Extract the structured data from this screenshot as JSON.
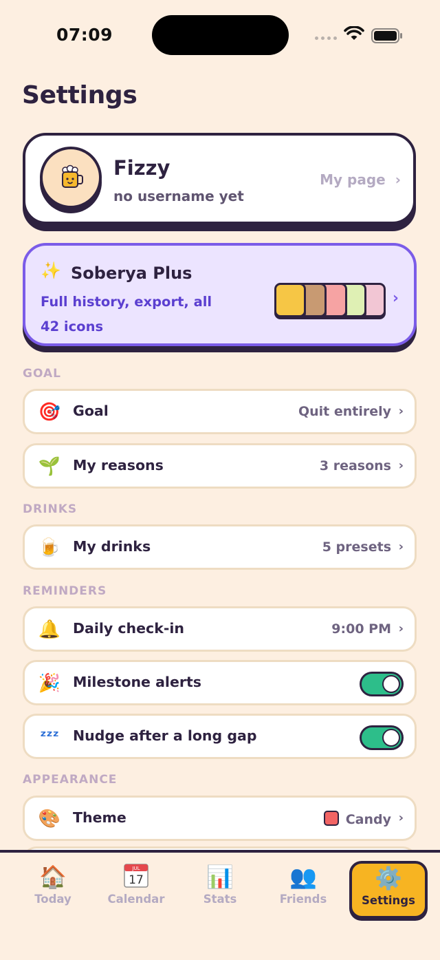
{
  "status_bar": {
    "time": "07:09"
  },
  "title": "Settings",
  "profile": {
    "name": "Fizzy",
    "subtitle": "no username yet",
    "link_label": "My page",
    "avatar_icon": "beer-mug-face-icon"
  },
  "plus": {
    "title": "Soberya Plus",
    "description": "Full history, export, all 42 icons",
    "sparkle_icon": "sparkles-icon",
    "accent": "#7b5ce8"
  },
  "sections": {
    "goal": {
      "label": "GOAL",
      "rows": [
        {
          "icon": "target-icon",
          "label": "Goal",
          "value": "Quit entirely"
        },
        {
          "icon": "seedling-icon",
          "label": "My reasons",
          "value": "3 reasons"
        }
      ]
    },
    "drinks": {
      "label": "DRINKS",
      "rows": [
        {
          "icon": "beer-mug-icon",
          "label": "My drinks",
          "value": "5 presets"
        }
      ]
    },
    "reminders": {
      "label": "REMINDERS",
      "rows": [
        {
          "icon": "bell-icon",
          "label": "Daily check-in",
          "value": "9:00 PM"
        },
        {
          "icon": "party-popper-icon",
          "label": "Milestone alerts",
          "toggle": true
        },
        {
          "icon": "zzz-icon",
          "label": "Nudge after a long gap",
          "toggle": true
        }
      ]
    },
    "appearance": {
      "label": "APPEARANCE",
      "rows": [
        {
          "icon": "palette-icon",
          "label": "Theme",
          "value": "Candy",
          "swatch_color": "#f26464"
        }
      ]
    }
  },
  "tabs": [
    {
      "label": "Today",
      "icon": "house-icon"
    },
    {
      "label": "Calendar",
      "icon": "calendar-icon"
    },
    {
      "label": "Stats",
      "icon": "bar-chart-icon"
    },
    {
      "label": "Friends",
      "icon": "people-icon"
    },
    {
      "label": "Settings",
      "icon": "gear-icon",
      "active": true
    }
  ],
  "calendar_icon": {
    "month": "JUL",
    "day": "17"
  },
  "colors": {
    "background": "#fdefe1",
    "ink": "#2e2240",
    "toggle_on": "#2dbe8a",
    "active_tab": "#f7b422"
  }
}
